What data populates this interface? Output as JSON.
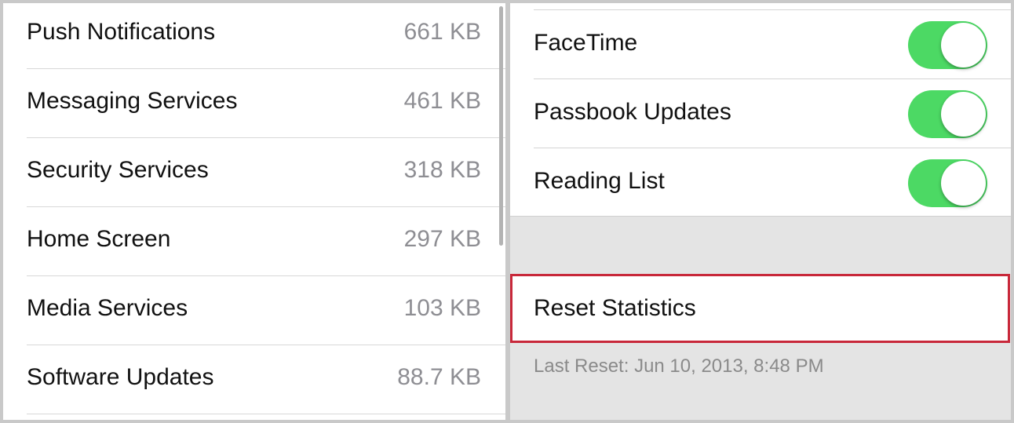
{
  "usage_list": [
    {
      "label": "Push Notifications",
      "value": "661 KB"
    },
    {
      "label": "Messaging Services",
      "value": "461 KB"
    },
    {
      "label": "Security Services",
      "value": "318 KB"
    },
    {
      "label": "Home Screen",
      "value": "297 KB"
    },
    {
      "label": "Media Services",
      "value": "103 KB"
    },
    {
      "label": "Software Updates",
      "value": "88.7 KB"
    }
  ],
  "toggles": [
    {
      "label": "FaceTime",
      "on": true
    },
    {
      "label": "Passbook Updates",
      "on": true
    },
    {
      "label": "Reading List",
      "on": true
    }
  ],
  "reset_label": "Reset Statistics",
  "last_reset": "Last Reset: Jun 10, 2013, 8:48 PM",
  "colors": {
    "toggle_on": "#4cd964",
    "highlight": "#c8283a"
  }
}
